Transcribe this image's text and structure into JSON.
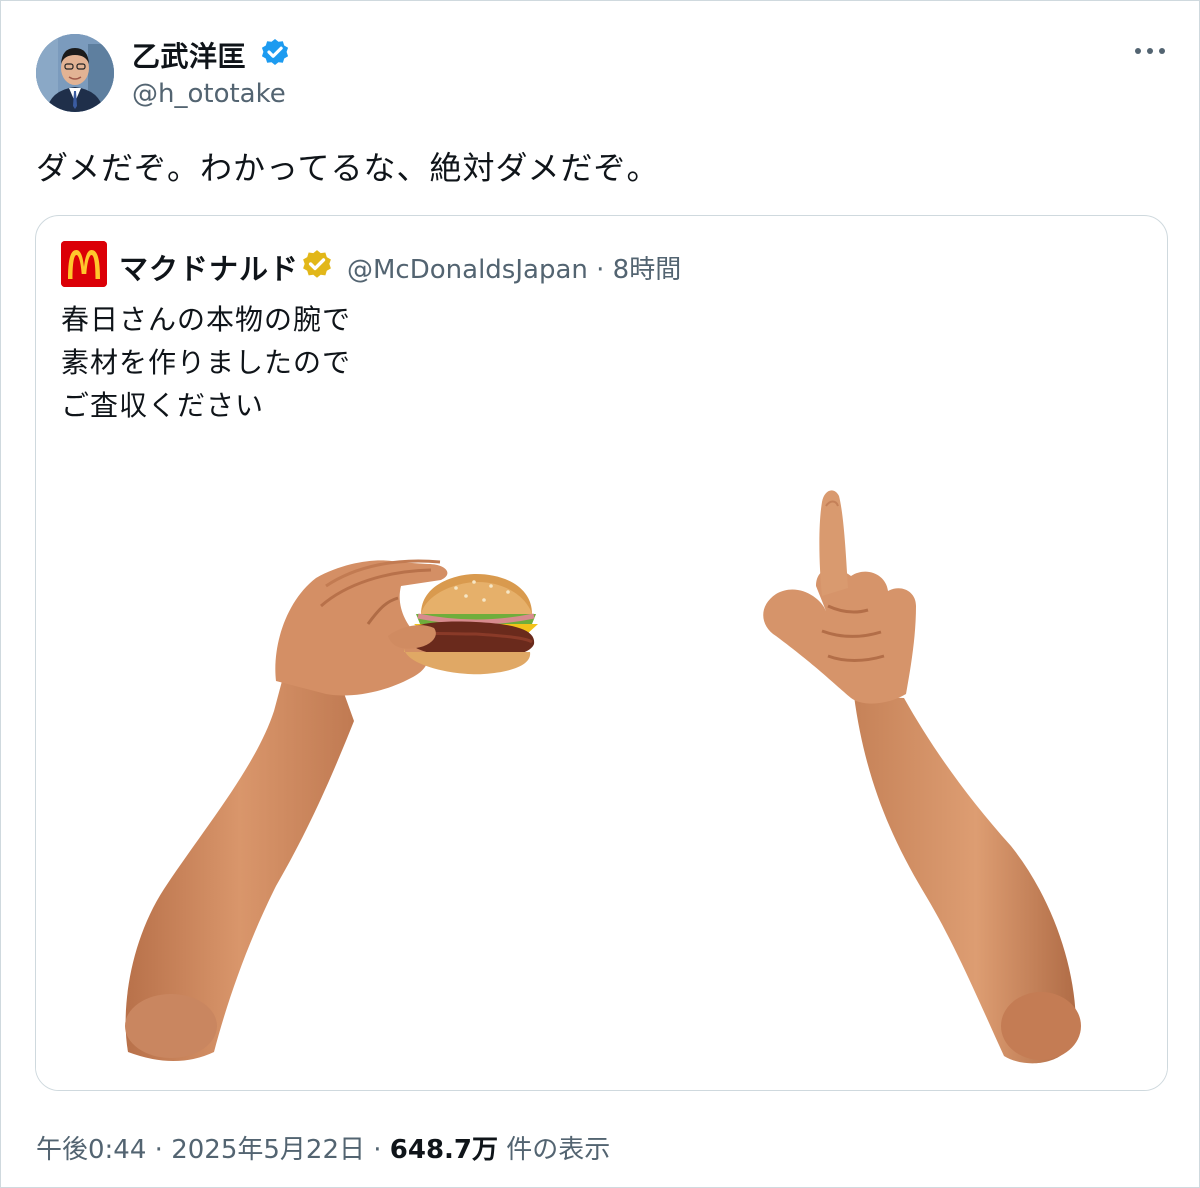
{
  "tweet": {
    "author": {
      "display_name": "乙武洋匡",
      "handle": "@h_ototake",
      "avatar_icon": "person-photo-icon",
      "verified_color": "#1d9bf0"
    },
    "text": "ダメだぞ。わかってるな、絶対ダメだぞ。",
    "more_icon": "more-horizontal-icon"
  },
  "quote": {
    "author": {
      "display_name": "マクドナルド",
      "handle": "@McDonaldsJapan",
      "separator": "·",
      "time": "8時間",
      "logo_icon": "mcdonalds-logo-icon",
      "verified_color": "#e2b719"
    },
    "text_lines": [
      "春日さんの本物の腕で",
      "素材を作りましたので",
      "ご査収ください"
    ],
    "image_icon": "arms-holding-burger-image"
  },
  "footer": {
    "time": "午後0:44",
    "separator1": "·",
    "date": "2025年5月22日",
    "separator2": "·",
    "views_count": "648.7万",
    "views_label": "件の表示"
  },
  "colors": {
    "text_primary": "#0f1419",
    "text_secondary": "#536471",
    "border": "#cfd9de",
    "mcdonalds_red": "#db0007",
    "mcdonalds_yellow": "#ffc72c"
  }
}
